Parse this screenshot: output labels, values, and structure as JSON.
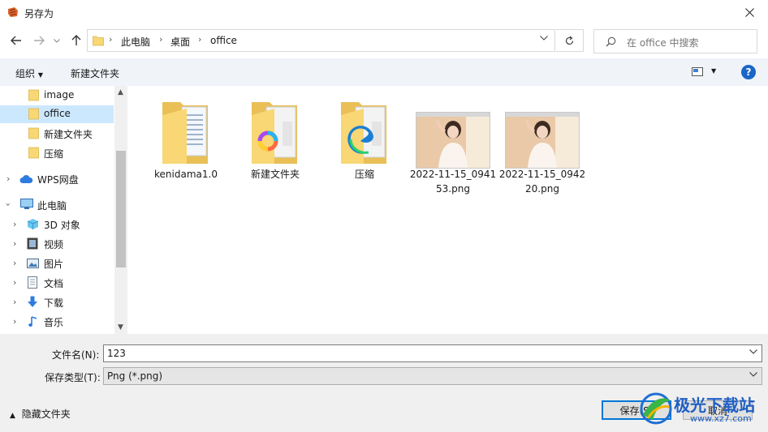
{
  "window": {
    "title": "另存为"
  },
  "address": {
    "crumbs": [
      "此电脑",
      "桌面",
      "office"
    ]
  },
  "search": {
    "placeholder": "在 office 中搜索"
  },
  "toolbar": {
    "organize": "组织",
    "new_folder": "新建文件夹",
    "help": "?"
  },
  "nav": {
    "items": [
      {
        "label": "image",
        "icon": "folder-icon"
      },
      {
        "label": "office",
        "icon": "folder-icon",
        "selected": true
      },
      {
        "label": "新建文件夹",
        "icon": "folder-icon"
      },
      {
        "label": "压缩",
        "icon": "folder-icon"
      },
      {
        "label": "WPS网盘",
        "icon": "cloud-icon"
      },
      {
        "label": "此电脑",
        "icon": "computer-icon"
      },
      {
        "label": "3D 对象",
        "icon": "cube-icon"
      },
      {
        "label": "视频",
        "icon": "video-icon"
      },
      {
        "label": "图片",
        "icon": "picture-icon"
      },
      {
        "label": "文档",
        "icon": "document-icon"
      },
      {
        "label": "下载",
        "icon": "download-icon"
      },
      {
        "label": "音乐",
        "icon": "music-icon"
      }
    ]
  },
  "files": [
    {
      "name": "kenidama1.0",
      "type": "folder-docs"
    },
    {
      "name": "新建文件夹",
      "type": "folder-colorful"
    },
    {
      "name": "压缩",
      "type": "folder-edge"
    },
    {
      "name": "2022-11-15_094153.png",
      "type": "image"
    },
    {
      "name": "2022-11-15_094220.png",
      "type": "image"
    }
  ],
  "form": {
    "filename_label": "文件名(N):",
    "filename_value": "123",
    "filetype_label": "保存类型(T):",
    "filetype_value": "Png (*.png)"
  },
  "footer": {
    "hide_folders": "隐藏文件夹",
    "save": "保存(S)",
    "cancel": "取消"
  },
  "watermark": {
    "text": "极光下载站",
    "url": "www.xz7.com"
  },
  "colors": {
    "accent": "#0078d7",
    "selected": "#cce8ff",
    "folder": "#f8d774",
    "toolbar": "#f0f3f8"
  }
}
